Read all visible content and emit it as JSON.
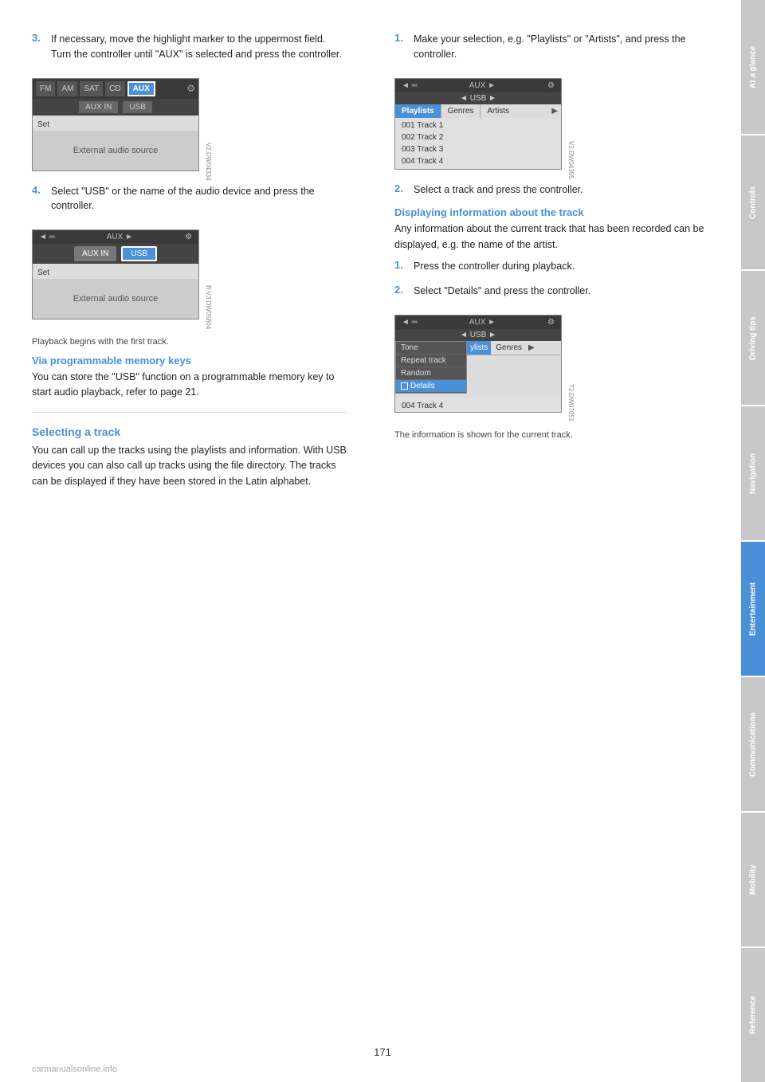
{
  "page": {
    "number": "171",
    "watermark": "carmanualsonline.info"
  },
  "sidebar": {
    "tabs": [
      {
        "id": "at-a-glance",
        "label": "At a glance",
        "active": false
      },
      {
        "id": "controls",
        "label": "Controls",
        "active": false
      },
      {
        "id": "driving-tips",
        "label": "Driving tips",
        "active": false
      },
      {
        "id": "navigation",
        "label": "Navigation",
        "active": false
      },
      {
        "id": "entertainment",
        "label": "Entertainment",
        "active": true
      },
      {
        "id": "communications",
        "label": "Communications",
        "active": false
      },
      {
        "id": "mobility",
        "label": "Mobility",
        "active": false
      },
      {
        "id": "reference",
        "label": "Reference",
        "active": false
      }
    ]
  },
  "left_column": {
    "step3": {
      "number": "3.",
      "text": "If necessary, move the highlight marker to the uppermost field. Turn the controller until \"AUX\" is selected and press the controller."
    },
    "screen1": {
      "top_buttons": [
        "FM",
        "AM",
        "SAT",
        "CD",
        "AUX"
      ],
      "active_button": "AUX",
      "row2_buttons": [
        "AUX IN",
        "USB"
      ],
      "set_label": "Set",
      "body_text": "External audio source",
      "img_num": "V2.DW04334"
    },
    "step4": {
      "number": "4.",
      "text": "Select \"USB\" or the name of the audio device and press the controller."
    },
    "screen2": {
      "top_text": "AUX",
      "row2_buttons": [
        "AUX IN",
        "USB"
      ],
      "active_button": "USB",
      "set_label": "Set",
      "body_text": "External audio source",
      "img_num": "B.V3.DW05804"
    },
    "caption1": "Playback begins with the first track.",
    "sub_heading_memory": "Via programmable memory keys",
    "text_memory": "You can store the \"USB\" function on a programmable memory key to start audio playback, refer to page 21.",
    "section_heading_track": "Selecting a track",
    "text_track": "You can call up the tracks using the playlists and information. With USB devices you can also call up tracks using the file directory. The tracks can be displayed if they have been stored in the Latin alphabet."
  },
  "right_column": {
    "step1": {
      "number": "1.",
      "text": "Make your selection, e.g. \"Playlists\" or \"Artists\", and press the controller."
    },
    "screen3": {
      "top_text": "AUX",
      "sub_top": "USB",
      "tabs": [
        "Playlists",
        "Genres",
        "Artists"
      ],
      "active_tab": "Playlists",
      "tracks": [
        "001 Track 1",
        "002 Track 2",
        "003 Track 3",
        "004 Track 4"
      ],
      "img_num": "V2.DW04355"
    },
    "step2": {
      "number": "2.",
      "text": "Select a track and press the controller."
    },
    "sub_heading_info": "Displaying information about the track",
    "text_info": "Any information about the current track that has been recorded can be displayed, e.g. the name of the artist.",
    "step1b": {
      "number": "1.",
      "text": "Press the controller during playback."
    },
    "step2b": {
      "number": "2.",
      "text": "Select \"Details\" and press the controller."
    },
    "screen4": {
      "top_text": "AUX",
      "sub_top": "USB",
      "menu_items": [
        "Tone",
        "Repeat track",
        "Random",
        "Details"
      ],
      "highlighted_item": "Details",
      "tab_partial": "ylists",
      "tab2": "Genres",
      "bottom_track": "004 Track 4",
      "img_num": "T2.DW07051"
    },
    "caption2": "The information is shown for the current track."
  }
}
